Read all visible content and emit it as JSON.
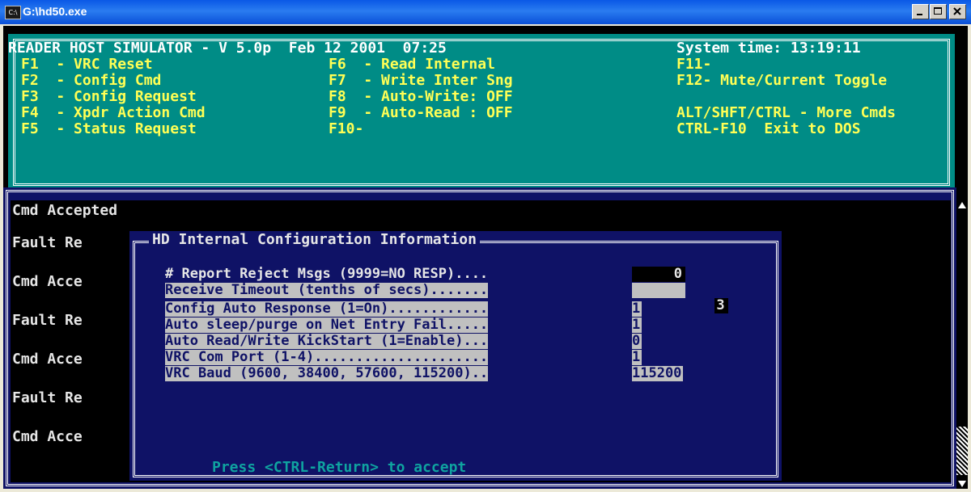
{
  "window": {
    "title": "G:\\hd50.exe",
    "icon": "console-icon",
    "icon_text": "C:\\"
  },
  "header": {
    "line1_left": "READER HOST SIMULATOR - V 5.0p  Feb 12 2001  07:25",
    "line1_right": "System time: 13:19:11",
    "col1": [
      "F1  - VRC Reset",
      "F2  - Config Cmd",
      "F3  - Config Request",
      "F4  - Xpdr Action Cmd",
      "F5  - Status Request"
    ],
    "col2": [
      "F6  - Read Internal",
      "F7  - Write Inter Sng",
      "F8  - Auto-Write: OFF",
      "F9  - Auto-Read : OFF",
      "F10-"
    ],
    "col3": [
      "F11-",
      "F12- Mute/Current Toggle",
      "",
      "ALT/SHFT/CTRL - More Cmds",
      "CTRL-F10  Exit to DOS"
    ]
  },
  "log": {
    "first": "Cmd Accepted",
    "lines": [
      "Fault Re",
      "Cmd Acce",
      "Fault Re",
      "Cmd Acce",
      "Fault Re",
      "Cmd Acce"
    ]
  },
  "dialog": {
    "title": "HD Internal Configuration Information",
    "rows": [
      {
        "label": "# Report Reject Msgs (9999=NO RESP)....",
        "value": "0"
      },
      {
        "label": "Receive Timeout (tenths of secs).......",
        "value": "3"
      },
      {
        "label": "Config Auto Response (1=On)............",
        "value": "1"
      },
      {
        "label": "Auto sleep/purge on Net Entry Fail.....",
        "value": "1"
      },
      {
        "label": "Auto Read/Write KickStart (1=Enable)...",
        "value": "0"
      },
      {
        "label": "VRC Com Port (1-4).....................",
        "value": "1"
      },
      {
        "label": "VRC Baud (9600, 38400, 57600, 115200)..",
        "value": "115200"
      }
    ],
    "footer": "Press <CTRL-Return> to accept"
  }
}
